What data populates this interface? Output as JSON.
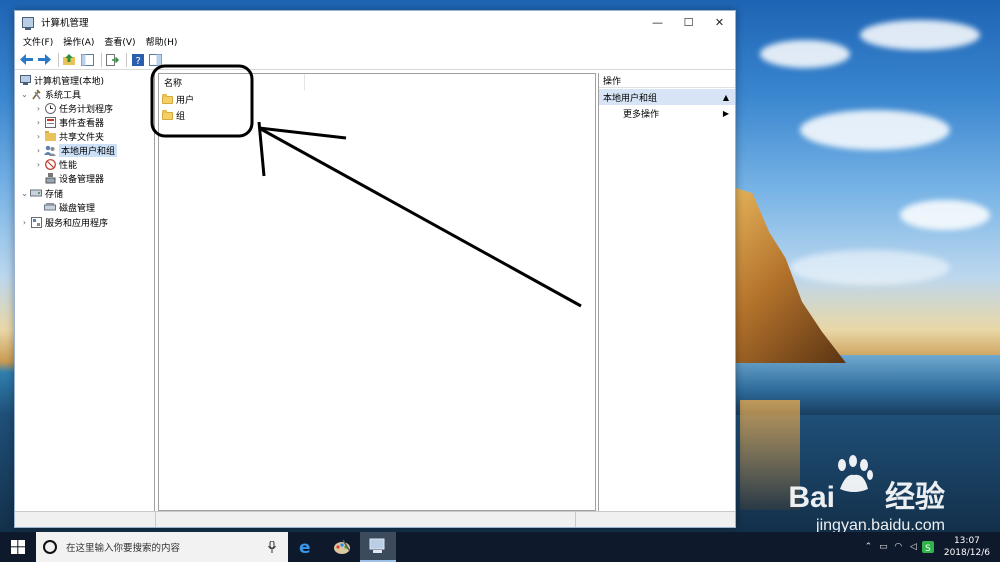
{
  "window": {
    "title": "计算机管理",
    "controls": {
      "minimize": "—",
      "maximize": "☐",
      "close": "✕"
    }
  },
  "menu": [
    "文件(F)",
    "操作(A)",
    "查看(V)",
    "帮助(H)"
  ],
  "tree": {
    "root": "计算机管理(本地)",
    "system_tools": "系统工具",
    "task_scheduler": "任务计划程序",
    "event_viewer": "事件查看器",
    "shared_folders": "共享文件夹",
    "local_users_groups": "本地用户和组",
    "performance": "性能",
    "device_manager": "设备管理器",
    "storage": "存储",
    "disk_management": "磁盘管理",
    "services_apps": "服务和应用程序"
  },
  "list": {
    "column_name": "名称",
    "items": [
      "用户",
      "组"
    ]
  },
  "actions": {
    "header": "操作",
    "section": "本地用户和组",
    "more": "更多操作"
  },
  "taskbar": {
    "search_placeholder": "在这里输入你要搜索的内容",
    "time": "13:07",
    "date": "2018/12/6"
  },
  "watermark": {
    "brand_left": "Bai",
    "brand_right": "经验",
    "url": "jingyan.baidu.com"
  },
  "colors": {
    "selection": "#cce0f7",
    "action_section": "#d6e4f5",
    "folder": "#f3cf66",
    "taskbar": "#0e1a2b"
  }
}
